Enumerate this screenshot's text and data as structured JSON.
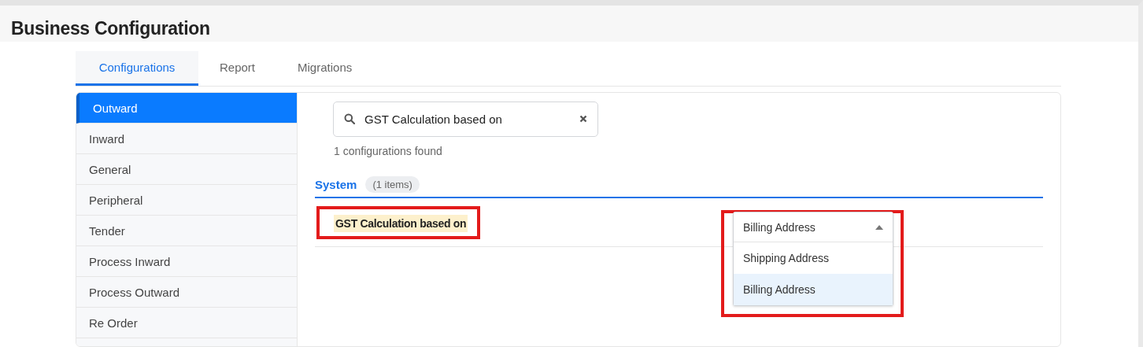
{
  "page": {
    "title": "Business Configuration"
  },
  "tabs": [
    {
      "label": "Configurations",
      "selected": true
    },
    {
      "label": "Report",
      "selected": false
    },
    {
      "label": "Migrations",
      "selected": false
    }
  ],
  "sidebar": {
    "items": [
      {
        "label": "Outward",
        "selected": true
      },
      {
        "label": "Inward",
        "selected": false
      },
      {
        "label": "General",
        "selected": false
      },
      {
        "label": "Peripheral",
        "selected": false
      },
      {
        "label": "Tender",
        "selected": false
      },
      {
        "label": "Process Inward",
        "selected": false
      },
      {
        "label": "Process Outward",
        "selected": false
      },
      {
        "label": "Re Order",
        "selected": false
      }
    ]
  },
  "search": {
    "value": "GST Calculation based on",
    "result_count": "1 configurations found"
  },
  "section": {
    "name": "System",
    "count": "(1 items)"
  },
  "settings": [
    {
      "label": "GST Calculation based on",
      "highlighted": true,
      "dropdown": {
        "value": "Billing Address",
        "expanded": true,
        "highlighted": true,
        "options": [
          {
            "label": "Shipping Address",
            "selected": false
          },
          {
            "label": "Billing Address",
            "selected": true
          }
        ]
      }
    }
  ]
}
